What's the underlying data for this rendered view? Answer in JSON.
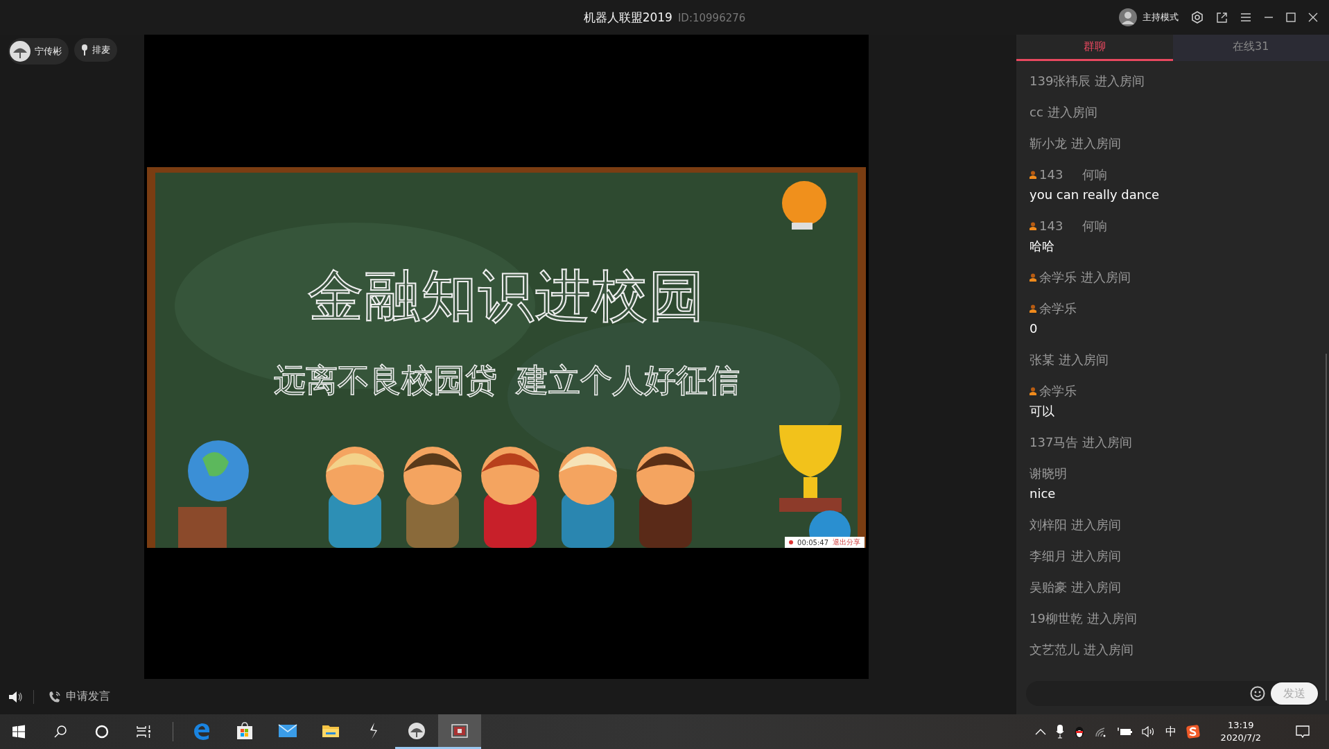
{
  "window": {
    "title": "机器人联盟2019",
    "room_id": "ID:10996276",
    "mode_label": "主持模式"
  },
  "presenter": {
    "name": "宁传彬",
    "queue_label": "排麦"
  },
  "slide": {
    "title": "金融知识进校园",
    "subtitle_parts": [
      "远离不良校园贷",
      "建立个人好征信"
    ],
    "share_timer": "00:05:47",
    "stop_share_label": "退出分享"
  },
  "bottom_bar": {
    "request_label": "申请发言"
  },
  "tabs": [
    {
      "label": "群聊",
      "selected": true
    },
    {
      "label": "在线31",
      "selected": false
    }
  ],
  "messages": [
    {
      "kind": "join",
      "badge": false,
      "text": "139张祎辰 进入房间"
    },
    {
      "kind": "join",
      "badge": false,
      "text": "cc 进入房间"
    },
    {
      "kind": "join",
      "badge": false,
      "text": "靳小龙 进入房间"
    },
    {
      "kind": "chat",
      "badge": true,
      "sender": "143",
      "note": "何响",
      "text": "you can really dance"
    },
    {
      "kind": "chat",
      "badge": true,
      "sender": "143",
      "note": "何响",
      "text": "哈哈"
    },
    {
      "kind": "join",
      "badge": true,
      "text": "余学乐 进入房间"
    },
    {
      "kind": "chat",
      "badge": true,
      "sender": "余学乐",
      "text": "0"
    },
    {
      "kind": "join",
      "badge": false,
      "text": "张某 进入房间"
    },
    {
      "kind": "chat",
      "badge": true,
      "sender": "余学乐",
      "text": "可以"
    },
    {
      "kind": "join",
      "badge": false,
      "text": "137马告 进入房间"
    },
    {
      "kind": "chat",
      "badge": false,
      "sender": "谢晓明",
      "text": "nice"
    },
    {
      "kind": "join",
      "badge": false,
      "text": "刘梓阳 进入房间"
    },
    {
      "kind": "join",
      "badge": false,
      "text": "李细月 进入房间"
    },
    {
      "kind": "join",
      "badge": false,
      "text": "吴贻豪 进入房间"
    },
    {
      "kind": "join",
      "badge": false,
      "text": "19柳世乾 进入房间"
    },
    {
      "kind": "join",
      "badge": false,
      "text": "文艺范儿 进入房间"
    }
  ],
  "composer": {
    "send_label": "发送"
  },
  "taskbar": {
    "apps": [
      {
        "kind": "edge",
        "running": false,
        "selected": false
      },
      {
        "kind": "store",
        "running": false,
        "selected": false
      },
      {
        "kind": "mail",
        "running": false,
        "selected": false
      },
      {
        "kind": "folder",
        "running": false,
        "selected": false
      },
      {
        "kind": "bolt",
        "running": false,
        "selected": false
      },
      {
        "kind": "round",
        "running": true,
        "selected": false
      },
      {
        "kind": "window",
        "running": true,
        "selected": true
      }
    ],
    "ime": "中",
    "time": "13:19",
    "date": "2020/7/2"
  }
}
